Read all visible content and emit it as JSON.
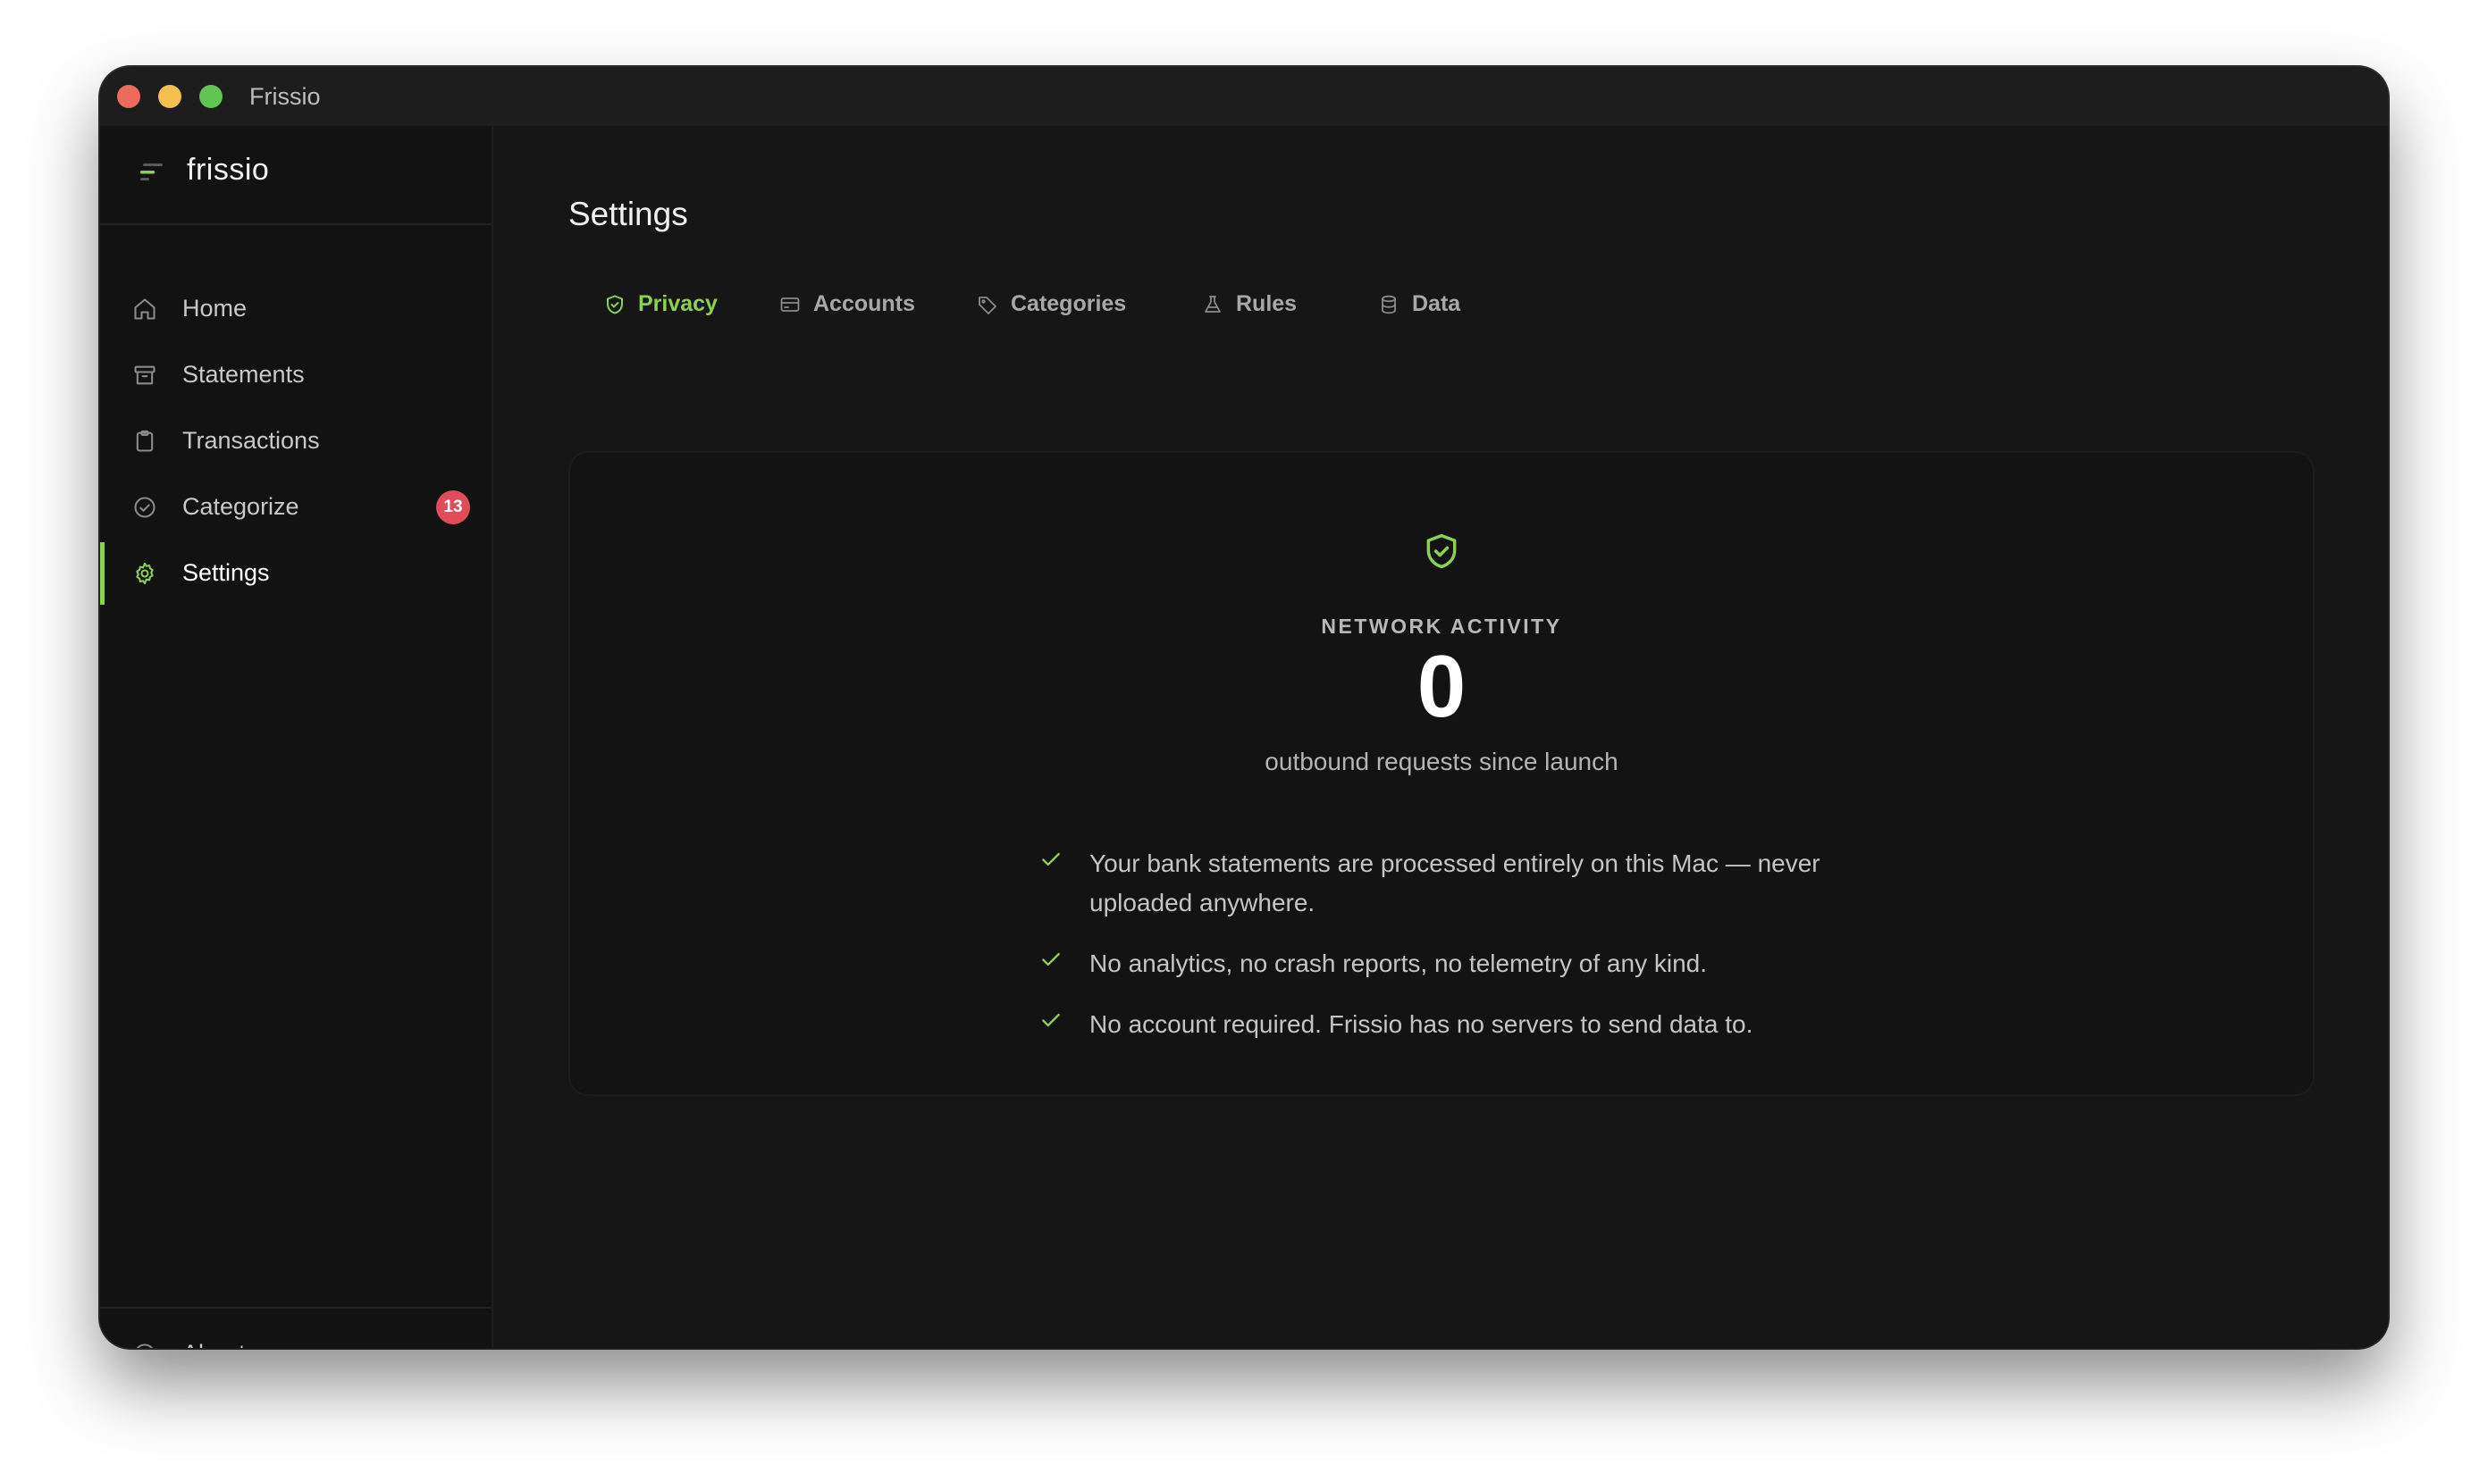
{
  "window": {
    "title": "Frissio"
  },
  "brand": {
    "name": "frissio"
  },
  "sidebar": {
    "items": [
      {
        "label": "Home",
        "icon": "home-icon"
      },
      {
        "label": "Statements",
        "icon": "archive-icon"
      },
      {
        "label": "Transactions",
        "icon": "clipboard-icon"
      },
      {
        "label": "Categorize",
        "icon": "check-circle-icon",
        "badge": "13"
      },
      {
        "label": "Settings",
        "icon": "gear-icon",
        "active": true
      }
    ],
    "footer": {
      "label": "About",
      "icon": "info-icon"
    }
  },
  "page": {
    "title": "Settings"
  },
  "tabs": [
    {
      "label": "Privacy",
      "icon": "shield-check-icon",
      "active": true
    },
    {
      "label": "Accounts",
      "icon": "credit-card-icon"
    },
    {
      "label": "Categories",
      "icon": "tag-icon"
    },
    {
      "label": "Rules",
      "icon": "flask-icon"
    },
    {
      "label": "Data",
      "icon": "database-icon"
    }
  ],
  "privacy": {
    "heading": "NETWORK ACTIVITY",
    "count": "0",
    "caption": "outbound requests since launch",
    "points": [
      "Your bank statements are processed entirely on this Mac — never uploaded anywhere.",
      "No analytics, no crash reports, no telemetry of any kind.",
      "No account required. Frissio has no servers to send data to."
    ]
  },
  "colors": {
    "accent": "#8bd14f",
    "badge": "#e14c5a",
    "background": "#161616",
    "sidebar": "#121212"
  }
}
